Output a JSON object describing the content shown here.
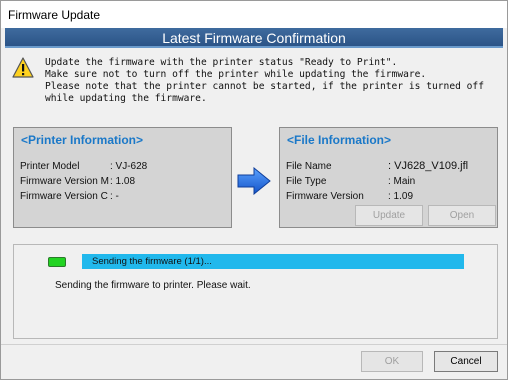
{
  "window": {
    "title": "Firmware Update",
    "banner": "Latest Firmware Confirmation"
  },
  "message": {
    "icon": "warning-icon",
    "lines": [
      "Update the firmware with the printer status \"Ready to Print\".",
      "Make sure not to turn off the printer while updating the firmware.",
      "Please note that the printer cannot be started, if the printer is turned off",
      "while updating the firmware."
    ]
  },
  "printer_info": {
    "header": "<Printer Information>",
    "model_label": "Printer Model",
    "model_value": ": VJ-628",
    "fw_m_label": "Firmware Version M",
    "fw_m_value": ": 1.08",
    "fw_c_label": "Firmware Version C",
    "fw_c_value": ": -"
  },
  "file_info": {
    "header": "<File Information>",
    "name_label": "File Name",
    "name_value": ": VJ628_V109.jfl",
    "type_label": "File Type",
    "type_value": ": Main",
    "version_label": "Firmware Version",
    "version_value": ": 1.09",
    "update_label": "Update",
    "open_label": "Open"
  },
  "progress": {
    "bar_text": "Sending the firmware (1/1)...",
    "status_text": "Sending the firmware to printer. Please wait.",
    "led_color": "#22d322",
    "bar_color": "#21b8ec"
  },
  "footer": {
    "ok_label": "OK",
    "cancel_label": "Cancel"
  },
  "colors": {
    "banner": "#2b5487",
    "panel_header": "#1a78c8",
    "arrow": "#1e6fe0"
  }
}
